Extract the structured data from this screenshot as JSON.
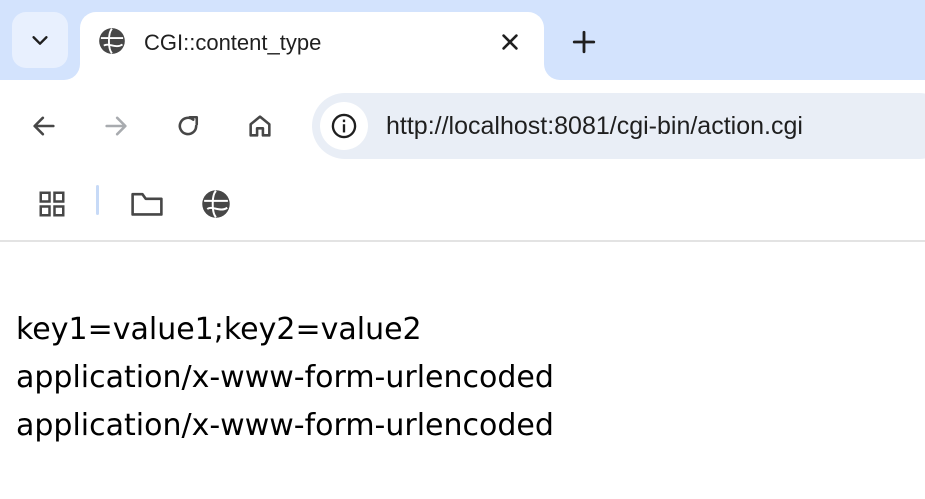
{
  "browser": {
    "tab": {
      "title": "CGI::content_type",
      "favicon": "globe-icon"
    },
    "tab_search_icon": "chevron-down-icon",
    "new_tab_icon": "plus-icon",
    "close_tab_icon": "close-icon",
    "toolbar": {
      "back_icon": "arrow-left-icon",
      "forward_icon": "arrow-right-icon",
      "reload_icon": "reload-icon",
      "home_icon": "home-icon",
      "site_info_icon": "info-icon",
      "url": "http://localhost:8081/cgi-bin/action.cgi"
    },
    "bookmarks_bar": {
      "items": [
        "apps-grid-icon",
        "folder-icon",
        "globe-icon"
      ]
    },
    "colors": {
      "tabstrip_bg": "#d3e3fd",
      "omnibox_bg": "#e9eef6",
      "icon": "#474747",
      "icon_disabled": "#a8abaf"
    }
  },
  "page": {
    "lines": [
      "key1=value1;key2=value2",
      "application/x-www-form-urlencoded",
      "application/x-www-form-urlencoded"
    ]
  }
}
